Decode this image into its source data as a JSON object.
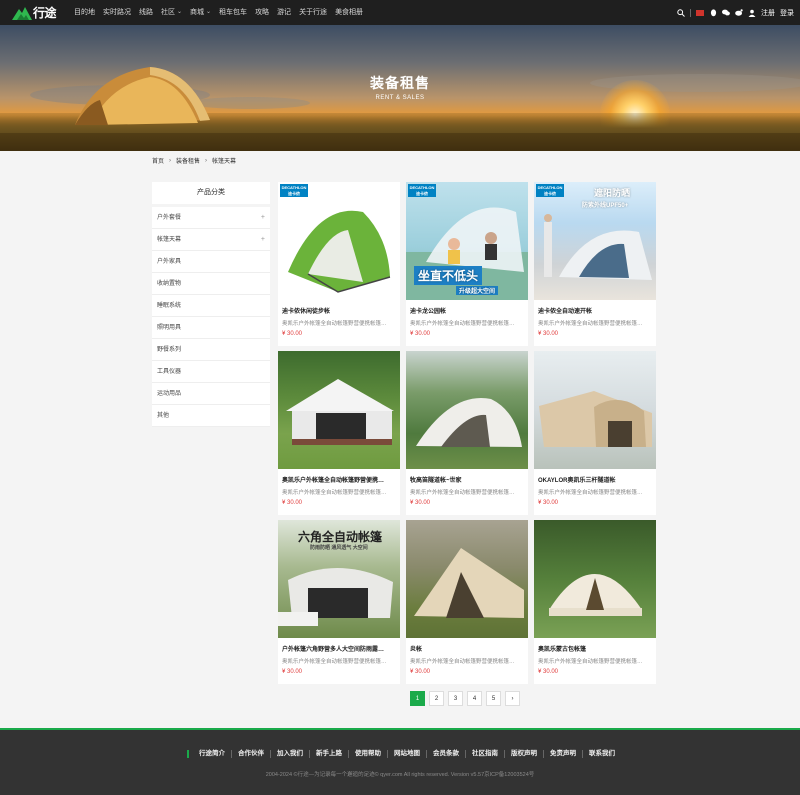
{
  "header": {
    "logo_text": "行途",
    "nav": [
      {
        "label": "目的地",
        "has_dropdown": false
      },
      {
        "label": "实时路况",
        "has_dropdown": false
      },
      {
        "label": "线路",
        "has_dropdown": false
      },
      {
        "label": "社区",
        "has_dropdown": true
      },
      {
        "label": "商城",
        "has_dropdown": true
      },
      {
        "label": "租车包车",
        "has_dropdown": false
      },
      {
        "label": "攻略",
        "has_dropdown": false
      },
      {
        "label": "游记",
        "has_dropdown": false
      },
      {
        "label": "关于行途",
        "has_dropdown": false
      },
      {
        "label": "美食相册",
        "has_dropdown": false
      }
    ],
    "register_label": "注册",
    "login_label": "登录"
  },
  "banner": {
    "title": "装备租售",
    "subtitle": "RENT & SALES"
  },
  "breadcrumb": [
    "首页",
    "装备租售",
    "帐篷天幕"
  ],
  "sidebar": {
    "title": "产品分类",
    "items": [
      {
        "label": "户外套餐",
        "expandable": true
      },
      {
        "label": "帐篷天幕",
        "expandable": true
      },
      {
        "label": "户外家具",
        "expandable": false
      },
      {
        "label": "收纳置物",
        "expandable": false
      },
      {
        "label": "睡眠系统",
        "expandable": false
      },
      {
        "label": "照明用具",
        "expandable": false
      },
      {
        "label": "野餐系列",
        "expandable": false
      },
      {
        "label": "工具仪器",
        "expandable": false
      },
      {
        "label": "运动用品",
        "expandable": false
      },
      {
        "label": "其他",
        "expandable": false
      }
    ]
  },
  "products": [
    {
      "name": "迪卡侬休闲徒步帐",
      "desc": "奥凯乐户外帐篷全自动帐篷野营便携帐篷…",
      "price": "¥ 30.00",
      "badge": "DECATHLON 迪卡侬",
      "caption": "",
      "caption2": ""
    },
    {
      "name": "迪卡龙公园帐",
      "desc": "奥凯乐户外帐篷全自动帐篷野营便携帐篷…",
      "price": "¥ 30.00",
      "badge": "DECATHLON 迪卡侬",
      "caption": "坐直不低头",
      "caption2": "升级超大空间"
    },
    {
      "name": "迪卡侬全自动速开帐",
      "desc": "奥凯乐户外帐篷全自动帐篷野营便携帐篷…",
      "price": "¥ 30.00",
      "badge": "DECATHLON 迪卡侬",
      "caption": "遮阳防晒",
      "caption2": "防紫外线UPF50+"
    },
    {
      "name": "奥凯乐户外帐篷全自动帐篷野营便携…",
      "desc": "奥凯乐户外帐篷全自动帐篷野营便携帐篷…",
      "price": "¥ 30.00",
      "badge": "",
      "caption": "",
      "caption2": ""
    },
    {
      "name": "牧高笛隧道帐~世家",
      "desc": "奥凯乐户外帐篷全自动帐篷野营便携帐篷…",
      "price": "¥ 30.00",
      "badge": "",
      "caption": "",
      "caption2": ""
    },
    {
      "name": "OKAYLOR奥凯乐三杆隧道帐",
      "desc": "奥凯乐户外帐篷全自动帐篷野营便携帐篷…",
      "price": "¥ 30.00",
      "badge": "",
      "caption": "",
      "caption2": ""
    },
    {
      "name": "户外帐篷六角野营多人大空间防雨露…",
      "desc": "奥凯乐户外帐篷全自动帐篷野营便携帐篷…",
      "price": "¥ 30.00",
      "badge": "",
      "caption": "六角全自动帐篷",
      "caption2": "防雨防晒 通风透气 大空间"
    },
    {
      "name": "炎帐",
      "desc": "奥凯乐户外帐篷全自动帐篷野营便携帐篷…",
      "price": "¥ 30.00",
      "badge": "",
      "caption": "",
      "caption2": ""
    },
    {
      "name": "奥凯乐蒙古包帐篷",
      "desc": "奥凯乐户外帐篷全自动帐篷野营便携帐篷…",
      "price": "¥ 30.00",
      "badge": "",
      "caption": "",
      "caption2": ""
    }
  ],
  "pagination": {
    "pages": [
      "1",
      "2",
      "3",
      "4",
      "5"
    ],
    "current": "1",
    "next_label": "›"
  },
  "footer": {
    "links": [
      "行途简介",
      "合作伙伴",
      "加入我们",
      "新手上路",
      "使用帮助",
      "网站地图",
      "会员条款",
      "社区指南",
      "版权声明",
      "免责声明",
      "联系我们"
    ],
    "copyright": "2004-2024 ©行途—为记录每一个邂逅的足迹© qyer.com All rights reserved. Version v5.57京ICP备12003524号"
  },
  "colors": {
    "accent": "#1aaa4a",
    "price": "#e03a3a",
    "topbar": "#1f1f1f",
    "footer": "#333333"
  }
}
